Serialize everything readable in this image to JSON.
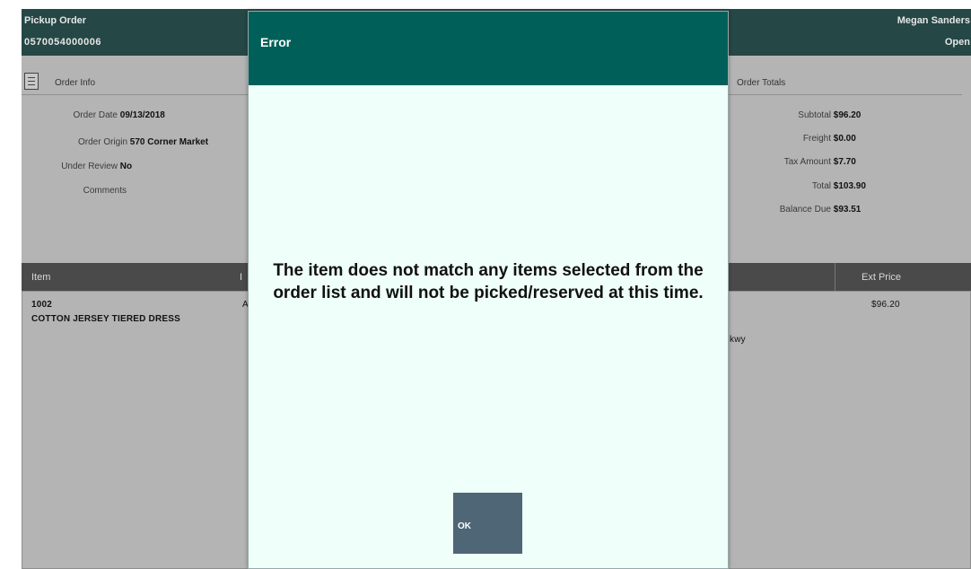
{
  "header": {
    "title": "Pickup Order",
    "order_number": "0570054000006",
    "user": "Megan Sanders",
    "status": "Open"
  },
  "order_info": {
    "section_title": "Order Info",
    "fields": [
      {
        "label": "Order Date",
        "value": "09/13/2018"
      },
      {
        "label": "Order Origin",
        "value": "570 Corner Market"
      },
      {
        "label": "Under Review",
        "value": "No"
      },
      {
        "label": "Comments",
        "value": ""
      }
    ]
  },
  "order_totals": {
    "section_title": "Order Totals",
    "fields": [
      {
        "label": "Subtotal",
        "value": "$96.20"
      },
      {
        "label": "Freight",
        "value": "$0.00"
      },
      {
        "label": "Tax Amount",
        "value": "$7.70"
      },
      {
        "label": "Total",
        "value": "$103.90"
      },
      {
        "label": "Balance Due",
        "value": "$93.51"
      }
    ]
  },
  "items_table": {
    "columns": [
      "Item",
      "I",
      "Ext Price"
    ],
    "rows": [
      {
        "item_id": "1002",
        "description": "COTTON JERSEY TIERED DRESS",
        "partial_col": "A",
        "address_fragment": "kwy",
        "ext_price": "$96.20"
      }
    ]
  },
  "dialog": {
    "title": "Error",
    "message": "The item does not match any items selected from the order list and will not be picked/reserved at this time.",
    "ok_label": "OK"
  },
  "colors": {
    "header_bg": "#254746",
    "modal_header_bg": "#006059",
    "modal_bg": "#effffa",
    "ok_button_bg": "#4e6676",
    "overlay_gray": "#b4b4b4"
  }
}
